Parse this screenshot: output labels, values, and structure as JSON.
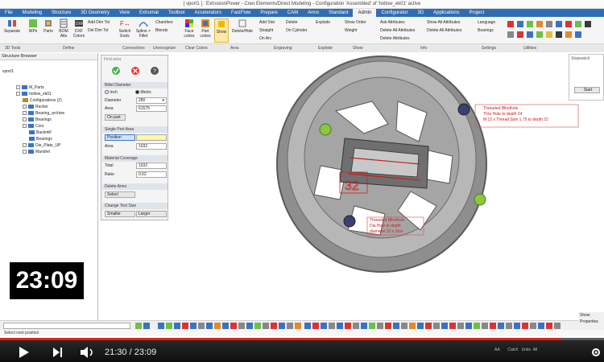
{
  "window": {
    "title": "[ vport1 ] : ExtrusionPower - Creo Elements/Direct Modeling - Configuration 'Assembled' of 'hollow_ek01' active"
  },
  "tabs": [
    "File",
    "Modeling",
    "Structure",
    "3D Geometry",
    "View",
    "Extrumat",
    "Toolbox",
    "Accelerators",
    "FastFlow",
    "Prepare",
    "CAM",
    "Anno",
    "Standard",
    "Admin",
    "Configurator",
    "3D",
    "Applications",
    "Project"
  ],
  "active_tab": "Admin",
  "ribbon": {
    "buttons": {
      "separate": "Separate",
      "wps": "WPs",
      "parts": "Parts",
      "bom_atts": "BOM Atts",
      "dxf_colors": "DXF Colors",
      "add_dim_tol": "Add Dim Tol",
      "del_dim_tol": "Del Dim Tol",
      "switch_ends": "Switch Ends",
      "spline_fillet": "Spline > Fillet",
      "chamfers": "Chamfers",
      "blends": "Blends",
      "face_colors": "Face colors",
      "part_colors": "Part colors",
      "show": "Show",
      "delete_hide": "Delete/Hide",
      "add_slot": "Add Slot",
      "straight": "Straight",
      "on_arc": "On Arc",
      "delete": "Delete",
      "on_cylinder": "On Cylinder",
      "explode": "Explode",
      "show_order": "Show Order",
      "weight": "Weight",
      "ask_attributes": "Ask Attributes",
      "delete_all_attributes": "Delete All Attributes",
      "show_all_attributes": "Show All Attributes",
      "delete_all_attributes_2": "Delete All Attributes",
      "delete_attributes": "Delete Attributes",
      "language": "Language",
      "bearings": "Bearings"
    },
    "groups": [
      "3D Tools",
      "Define",
      "Connections",
      "Unrecognize",
      "Clear Colors",
      "Area",
      "Engraving",
      "Explode",
      "Show",
      "Info",
      "Settings",
      "Utilities"
    ]
  },
  "browser": {
    "title": "Structure Browser",
    "root": "vport1",
    "items": [
      "M_Parts",
      "hollow_ek01",
      "Configurations (2)",
      "Recker",
      "Bearing_archive",
      "Bearings",
      "Cors",
      "Backmill",
      "Bearings",
      "Die_Plate_UP",
      "Mandrel"
    ]
  },
  "panel": {
    "title": "Find area",
    "sections": {
      "billet": "Billet Diameter",
      "single_port": "Single Port Area",
      "material": "Material Coverage",
      "delete_anno": "Delete Anno",
      "text_size": "Change Text Size"
    },
    "inch": "Inch",
    "metric": "Metric",
    "diameter_label": "Diameter",
    "diameter_value": "280",
    "area_label": "Area",
    "area_value": "61575",
    "on_part": "On part",
    "position_label": "Position",
    "port_area_label": "Area",
    "port_area_value": "1032",
    "total_label": "Total",
    "total_value": "1032",
    "ratio_label": "Ratio",
    "ratio_value": "0.02",
    "select": "Select",
    "smaller": "Smaller",
    "larger": "Larger"
  },
  "viewport": {
    "annotation_top": [
      "Threaded Blindhole",
      "Thru Hole to depth 24",
      "M 12 x Thread Size 1.75 to depth 22"
    ],
    "annotation_bottom": [
      "Threaded Blindhole",
      "Dia Hole to depth",
      "diameter 12 x Size"
    ],
    "number_label": "32"
  },
  "right_panel": {
    "title": "Stopwatch",
    "start": "Start"
  },
  "command": {
    "show_property": "Show Properties"
  },
  "status": {
    "text": "Select next position"
  },
  "player": {
    "current": "21:30",
    "duration": "23:09",
    "progress_fraction": 0.929,
    "right_items": [
      "AA",
      "Catch",
      "Units",
      "All"
    ]
  },
  "overlay_timer": "23:09"
}
